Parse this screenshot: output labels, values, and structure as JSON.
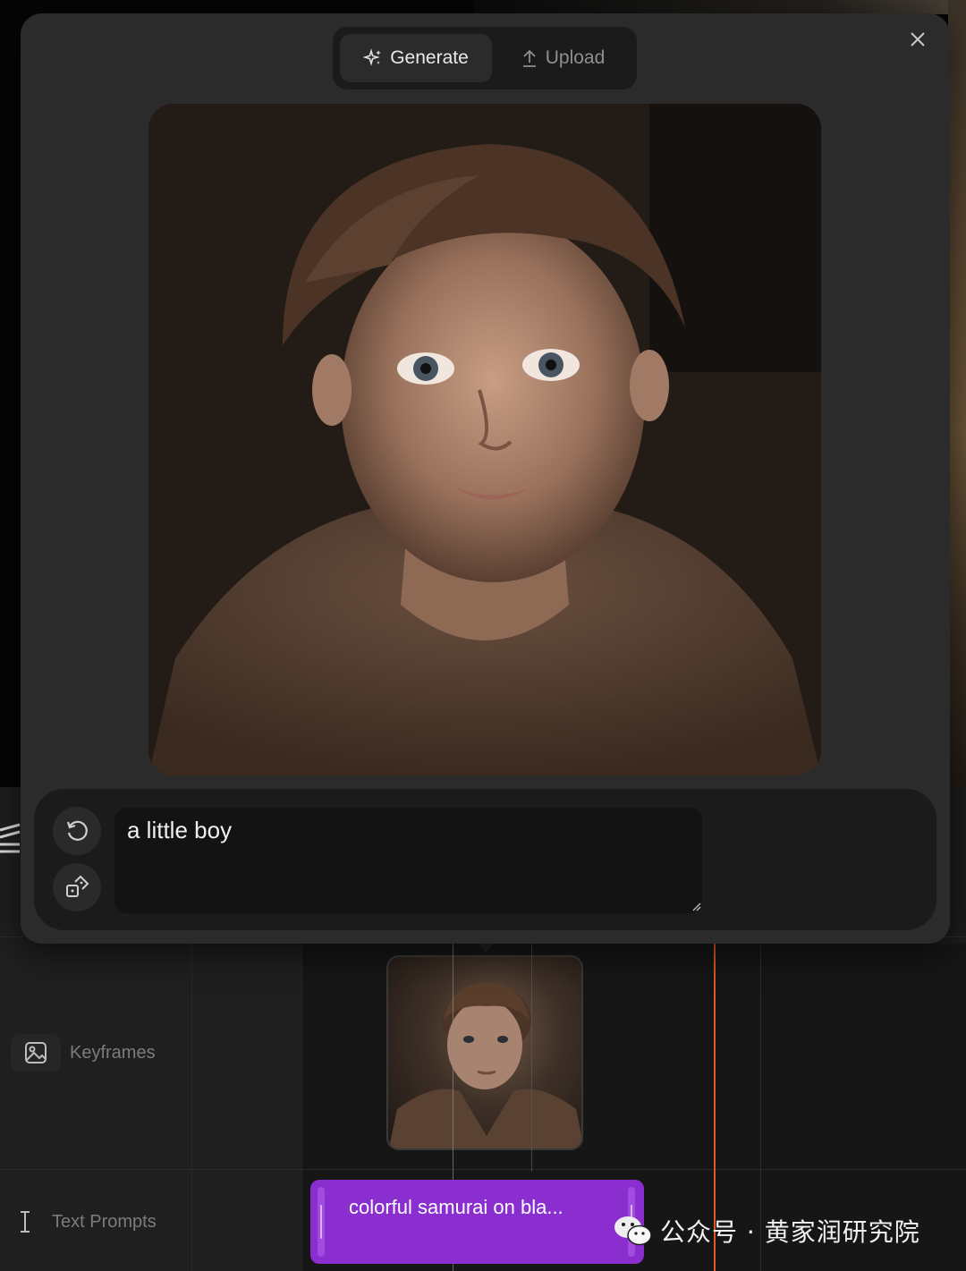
{
  "modal": {
    "tabs": [
      {
        "label": "Generate",
        "icon": "sparkle-icon",
        "active": true
      },
      {
        "label": "Upload",
        "icon": "upload-icon",
        "active": false
      }
    ],
    "close_icon": "close-icon",
    "preview_alt": "a little boy",
    "prompt": {
      "value": "a little boy",
      "actions": [
        {
          "icon": "refresh-icon"
        },
        {
          "icon": "dice-icon"
        }
      ]
    }
  },
  "timeline": {
    "tracks": [
      {
        "label": "Keyframes",
        "icon": "image-icon"
      },
      {
        "label": "Text Prompts",
        "icon": "text-cursor-icon"
      }
    ],
    "prompt_clip": {
      "text": "colorful samurai on bla..."
    }
  },
  "watermark": {
    "text": "公众号 · 黄家润研究院",
    "icon": "wechat-icon"
  },
  "colors": {
    "accent_purple": "#8a2ed0",
    "playhead": "#e2571e",
    "modal_bg": "#2b2b2b"
  }
}
